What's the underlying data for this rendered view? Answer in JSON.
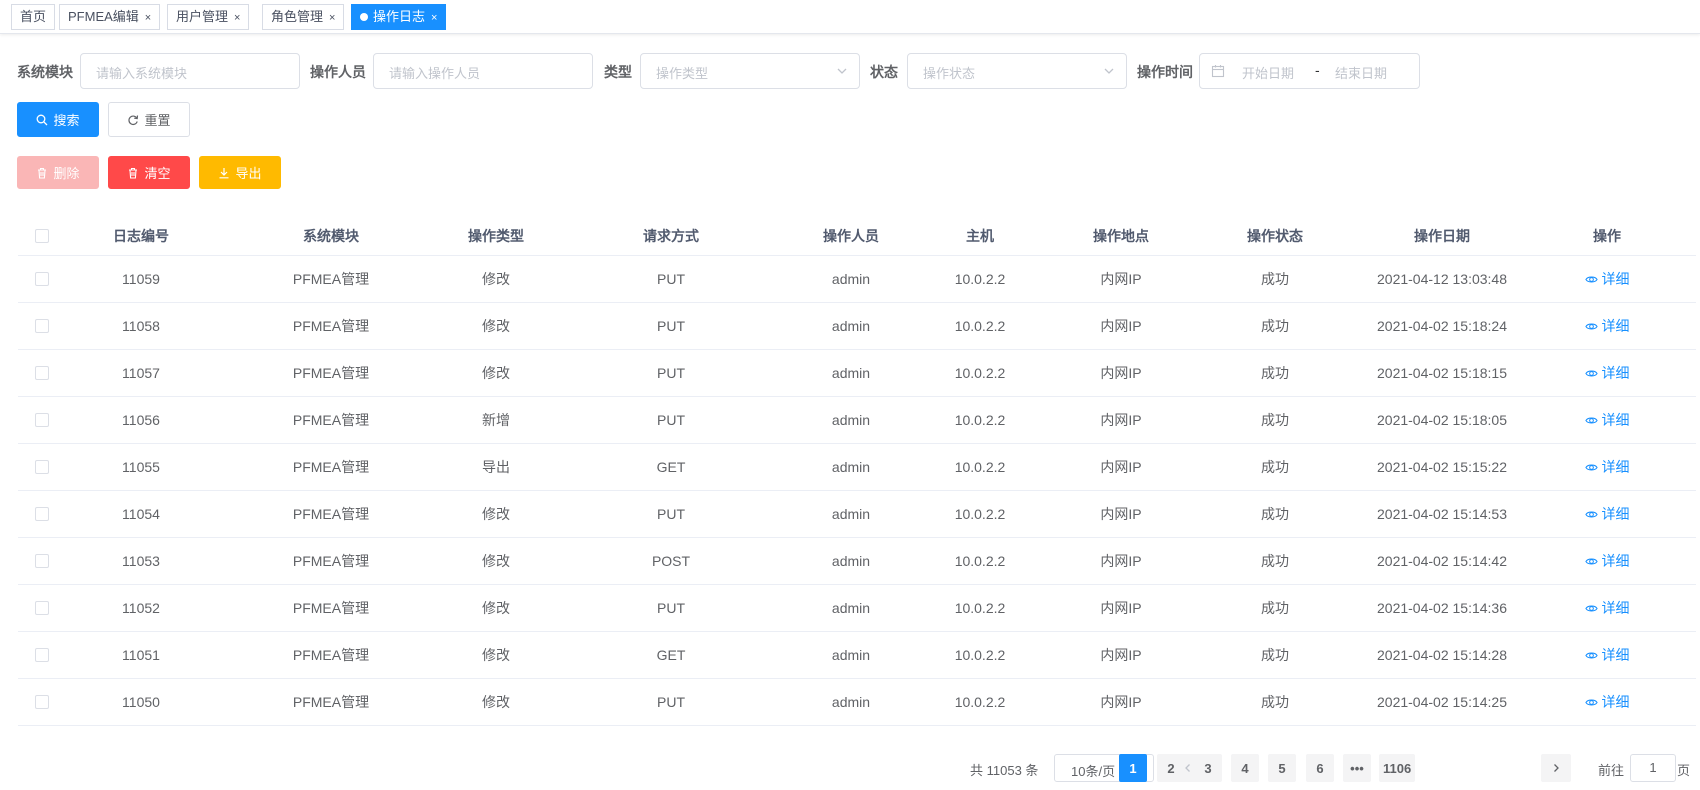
{
  "tabs": [
    {
      "label": "首页",
      "closable": false,
      "active": false
    },
    {
      "label": "PFMEA编辑",
      "closable": true,
      "active": false
    },
    {
      "label": "用户管理",
      "closable": true,
      "active": false
    },
    {
      "label": "角色管理",
      "closable": true,
      "active": false
    },
    {
      "label": "操作日志",
      "closable": true,
      "active": true
    }
  ],
  "tab_close_glyph": "×",
  "filters": {
    "module_label": "系统模块",
    "module_placeholder": "请输入系统模块",
    "operator_label": "操作人员",
    "operator_placeholder": "请输入操作人员",
    "type_label": "类型",
    "type_placeholder": "操作类型",
    "status_label": "状态",
    "status_placeholder": "操作状态",
    "time_label": "操作时间",
    "start_placeholder": "开始日期",
    "date_separator": "-",
    "end_placeholder": "结束日期"
  },
  "actions": {
    "search": "搜索",
    "reset": "重置",
    "delete": "删除",
    "clear": "清空",
    "export": "导出"
  },
  "table": {
    "columns": [
      "日志编号",
      "系统模块",
      "操作类型",
      "请求方式",
      "操作人员",
      "主机",
      "操作地点",
      "操作状态",
      "操作日期",
      "操作"
    ],
    "detail_label": "详细",
    "rows": [
      [
        "11059",
        "PFMEA管理",
        "修改",
        "PUT",
        "admin",
        "10.0.2.2",
        "内网IP",
        "成功",
        "2021-04-12 13:03:48"
      ],
      [
        "11058",
        "PFMEA管理",
        "修改",
        "PUT",
        "admin",
        "10.0.2.2",
        "内网IP",
        "成功",
        "2021-04-02 15:18:24"
      ],
      [
        "11057",
        "PFMEA管理",
        "修改",
        "PUT",
        "admin",
        "10.0.2.2",
        "内网IP",
        "成功",
        "2021-04-02 15:18:15"
      ],
      [
        "11056",
        "PFMEA管理",
        "新增",
        "PUT",
        "admin",
        "10.0.2.2",
        "内网IP",
        "成功",
        "2021-04-02 15:18:05"
      ],
      [
        "11055",
        "PFMEA管理",
        "导出",
        "GET",
        "admin",
        "10.0.2.2",
        "内网IP",
        "成功",
        "2021-04-02 15:15:22"
      ],
      [
        "11054",
        "PFMEA管理",
        "修改",
        "PUT",
        "admin",
        "10.0.2.2",
        "内网IP",
        "成功",
        "2021-04-02 15:14:53"
      ],
      [
        "11053",
        "PFMEA管理",
        "修改",
        "POST",
        "admin",
        "10.0.2.2",
        "内网IP",
        "成功",
        "2021-04-02 15:14:42"
      ],
      [
        "11052",
        "PFMEA管理",
        "修改",
        "PUT",
        "admin",
        "10.0.2.2",
        "内网IP",
        "成功",
        "2021-04-02 15:14:36"
      ],
      [
        "11051",
        "PFMEA管理",
        "修改",
        "GET",
        "admin",
        "10.0.2.2",
        "内网IP",
        "成功",
        "2021-04-02 15:14:28"
      ],
      [
        "11050",
        "PFMEA管理",
        "修改",
        "PUT",
        "admin",
        "10.0.2.2",
        "内网IP",
        "成功",
        "2021-04-02 15:14:25"
      ]
    ]
  },
  "pagination": {
    "total": "共 11053 条",
    "page_size": "10条/页",
    "pages": [
      "1",
      "2",
      "3",
      "4",
      "5",
      "6",
      "•••",
      "1106"
    ],
    "current": "1",
    "goto_label": "前往",
    "goto_value": "1",
    "page_suffix": "页"
  },
  "colors": {
    "primary": "#1890ff",
    "danger": "#ff4949",
    "danger_disabled": "#fab6b6",
    "warning": "#ffba00"
  }
}
